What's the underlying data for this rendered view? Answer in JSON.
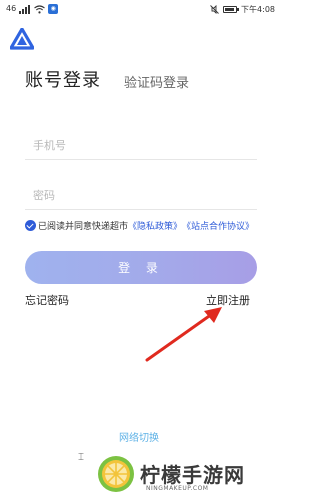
{
  "status_bar": {
    "left_text": "46",
    "time_label": "下午4:08"
  },
  "tabs": {
    "active": "账号登录",
    "inactive": "验证码登录"
  },
  "form": {
    "phone_placeholder": "手机号",
    "password_placeholder": "密码"
  },
  "agreement": {
    "prefix": "已阅读并同意快递超市",
    "privacy_link": "《隐私政策》",
    "site_link": "《站点合作协议》"
  },
  "login_button": "登 录",
  "forgot_password": "忘记密码",
  "register": "立即注册",
  "network_switch": "网络切换",
  "watermark": {
    "title": "柠檬手游网",
    "url": "NINGMAKEUP.COM"
  },
  "colors": {
    "accent": "#2e5bd8",
    "button_gradient_start": "#9fb2ee",
    "button_gradient_end": "#a79ee6",
    "arrow": "#e02a1f",
    "network_link": "#5fb2e6"
  }
}
